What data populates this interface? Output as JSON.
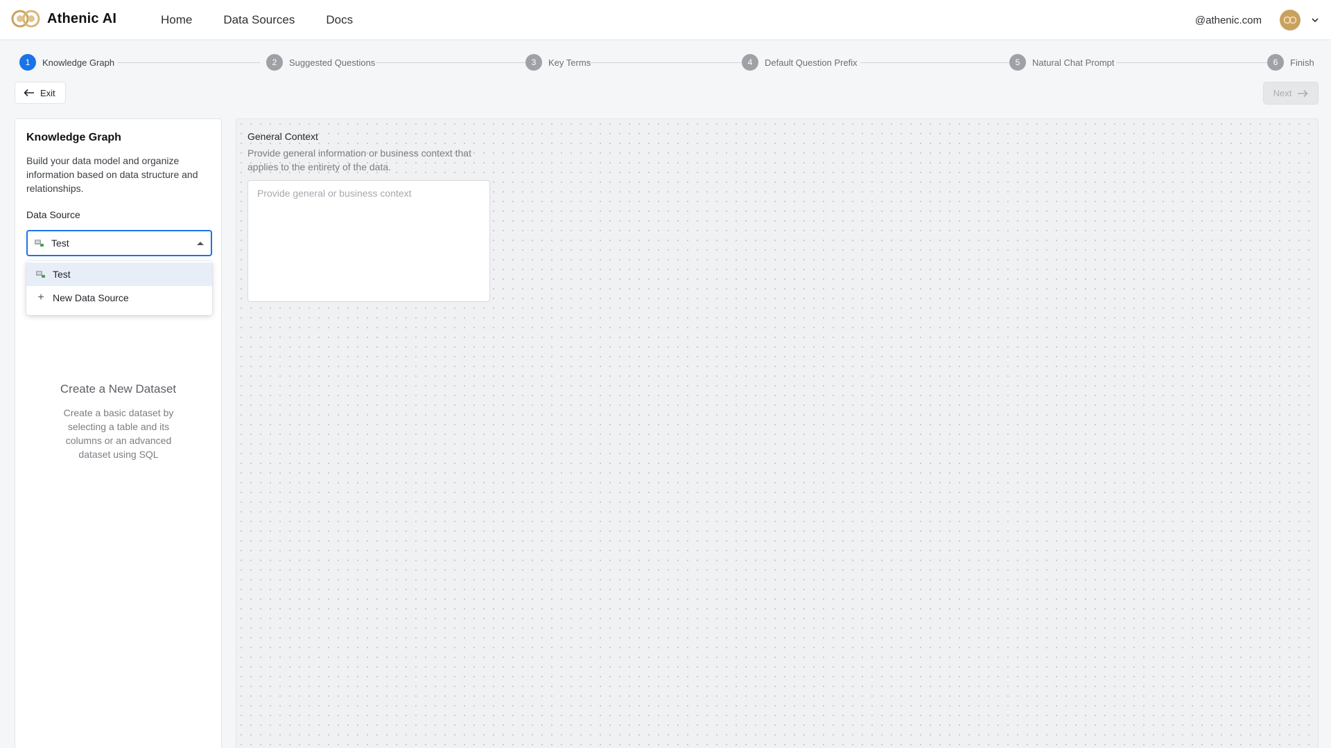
{
  "brand": {
    "name": "Athenic AI"
  },
  "nav": {
    "items": [
      "Home",
      "Data Sources",
      "Docs"
    ]
  },
  "user": {
    "email": "@athenic.com",
    "avatar_icon": "logo-icon",
    "menu_icon": "chevron-down-icon"
  },
  "stepper": {
    "active": 1,
    "steps": [
      {
        "num": "1",
        "label": "Knowledge Graph"
      },
      {
        "num": "2",
        "label": "Suggested Questions"
      },
      {
        "num": "3",
        "label": "Key Terms"
      },
      {
        "num": "4",
        "label": "Default Question Prefix"
      },
      {
        "num": "5",
        "label": "Natural Chat Prompt"
      },
      {
        "num": "6",
        "label": "Finish"
      }
    ]
  },
  "actions": {
    "exit_label": "Exit",
    "next_label": "Next"
  },
  "left_panel": {
    "title": "Knowledge Graph",
    "description": "Build your data model and organize information based on data structure and relationships.",
    "data_source_label": "Data Source",
    "selected_value": "Test",
    "options": [
      {
        "label": "Test",
        "icon": "database-icon"
      },
      {
        "label": "New Data Source",
        "icon": "plus-icon"
      }
    ],
    "empty_title": "Create a New Dataset",
    "empty_description": "Create a basic dataset by selecting a table and its columns or an advanced dataset using SQL"
  },
  "general_context": {
    "title": "General Context",
    "description": "Provide general information or business context that applies to the entirety of the data.",
    "placeholder": "Provide general or business context"
  },
  "colors": {
    "accent": "#1a73e8",
    "step_inactive": "#9ea2a7",
    "brand_gold": "#c9a15f"
  }
}
